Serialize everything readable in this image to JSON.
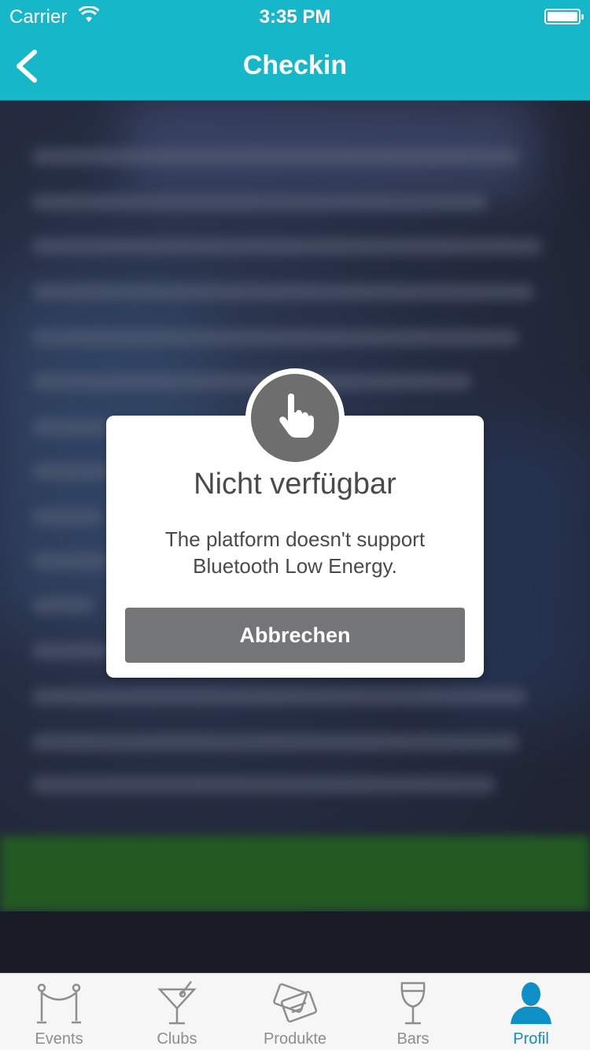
{
  "status_bar": {
    "carrier": "Carrier",
    "time": "3:35 PM"
  },
  "nav": {
    "title": "Checkin"
  },
  "dialog": {
    "title": "Nicht verfügbar",
    "message": "The platform doesn't support Bluetooth Low Energy.",
    "button_label": "Abbrechen",
    "icon": "pointing-hand-icon"
  },
  "tabbar": {
    "active": "Profil",
    "active_color": "#0e8fc5",
    "items": [
      {
        "label": "Events",
        "icon": "rope-barrier-icon"
      },
      {
        "label": "Clubs",
        "icon": "cocktail-glass-icon"
      },
      {
        "label": "Produkte",
        "icon": "tickets-icon"
      },
      {
        "label": "Bars",
        "icon": "wine-glass-icon"
      },
      {
        "label": "Profil",
        "icon": "person-icon"
      }
    ]
  },
  "colors": {
    "header": "#15b7c9",
    "dialog_button": "#747576"
  }
}
